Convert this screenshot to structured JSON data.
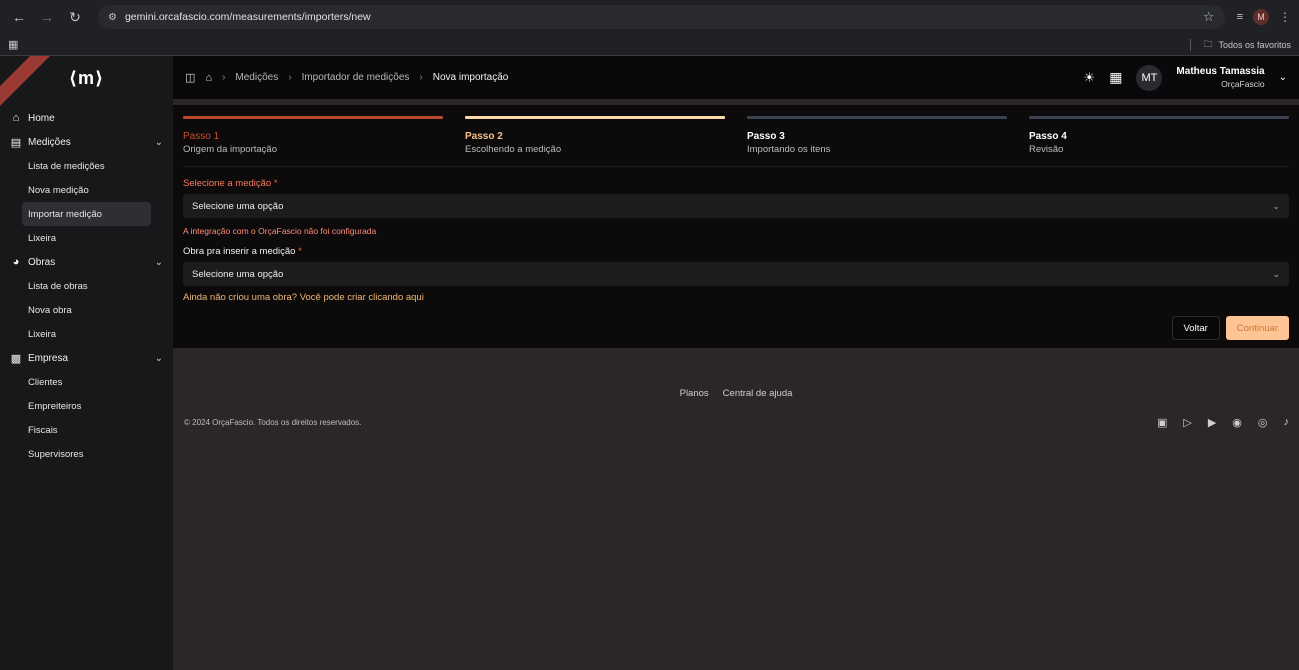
{
  "browser": {
    "url": "gemini.orcafascio.com/measurements/importers/new",
    "bookmarks_label": "Todos os favoritos",
    "profile_initial": "M"
  },
  "sidebar": {
    "logo_text": "⟨m⟩",
    "items": [
      {
        "label": "Home",
        "icon": "home-icon"
      },
      {
        "label": "Medições",
        "icon": "clipboard-icon",
        "children": [
          "Lista de medições",
          "Nova medição",
          "Importar medição",
          "Lixeira"
        ]
      },
      {
        "label": "Obras",
        "icon": "helmet-icon",
        "children": [
          "Lista de obras",
          "Nova obra",
          "Lixeira"
        ]
      },
      {
        "label": "Empresa",
        "icon": "building-icon",
        "children": [
          "Clientes",
          "Empreiteiros",
          "Fiscais",
          "Supervisores"
        ]
      }
    ],
    "active_item": "Importar medição"
  },
  "topbar": {
    "breadcrumbs": [
      "Medições",
      "Importador de medições",
      "Nova importação"
    ],
    "user_initials": "MT",
    "user_name": "Matheus Tamassia",
    "user_org": "OrçaFascio"
  },
  "steps": [
    {
      "num": "Passo 1",
      "desc": "Origem da importação",
      "color": "#b8482c",
      "num_color": "#c4502f"
    },
    {
      "num": "Passo 2",
      "desc": "Escolhendo a medição",
      "color": "#fcd9a6",
      "num_color": "#f6c08a"
    },
    {
      "num": "Passo 3",
      "desc": "Importando os itens",
      "color": "#3b4251",
      "num_color": "#ffffff"
    },
    {
      "num": "Passo 4",
      "desc": "Revisão",
      "color": "#3b4251",
      "num_color": "#ffffff"
    }
  ],
  "form": {
    "measurement_label": "Selecione a medição",
    "measurement_placeholder": "Selecione uma opção",
    "measurement_error": "A integração com o OrçaFascio não foi configurada",
    "work_label": "Obra pra inserir a medição",
    "work_placeholder": "Selecione uma opção",
    "work_hint": "Ainda não criou uma obra? Você pode criar clicando aqui",
    "back_label": "Voltar",
    "continue_label": "Continuar"
  },
  "footer": {
    "links": [
      "Planos",
      "Central de ajuda"
    ],
    "copyright": "© 2024 OrçaFascio. Todos os direitos reservados.",
    "socials": [
      "linkedin-icon",
      "play-icon",
      "youtube-icon",
      "facebook-icon",
      "instagram-icon",
      "tiktok-icon"
    ]
  },
  "colors": {
    "accent": "#ffc493",
    "error": "#ff8f7a",
    "required_label": "#ff7a63"
  }
}
